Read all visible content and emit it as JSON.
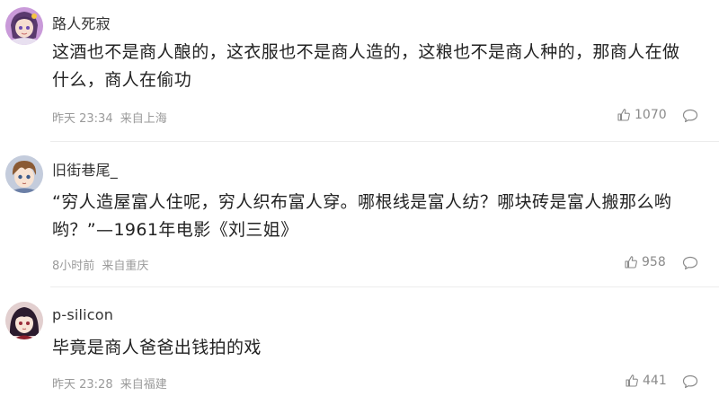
{
  "comments": [
    {
      "username": "路人死寂",
      "text": "这酒也不是商人酿的，这衣服也不是商人造的，这粮也不是商人种的，那商人在做什么，商人在偷功",
      "time": "昨天 23:34",
      "location": "来自上海",
      "likes": "1070",
      "avatar_icon": "anime-girl-avatar-icon"
    },
    {
      "username": "旧街巷尾_",
      "text": "“穷人造屋富人住呢，穷人织布富人穿。哪根线是富人纺？哪块砖是富人搬那么哟哟？”—1961年电影《刘三姐》",
      "time": "8小时前",
      "location": "来自重庆",
      "likes": "958",
      "avatar_icon": "anime-boy-avatar-icon"
    },
    {
      "username": "p-silicon",
      "text": "毕竟是商人爸爸出钱拍的戏",
      "time": "昨天 23:28",
      "location": "来自福建",
      "likes": "441",
      "avatar_icon": "dark-haired-girl-avatar-icon"
    }
  ],
  "icons": {
    "like": "thumbs-up-icon",
    "reply": "comment-bubble-icon"
  },
  "colors": {
    "text": "#222222",
    "meta": "#9a9a9a",
    "divider": "#ececec"
  }
}
